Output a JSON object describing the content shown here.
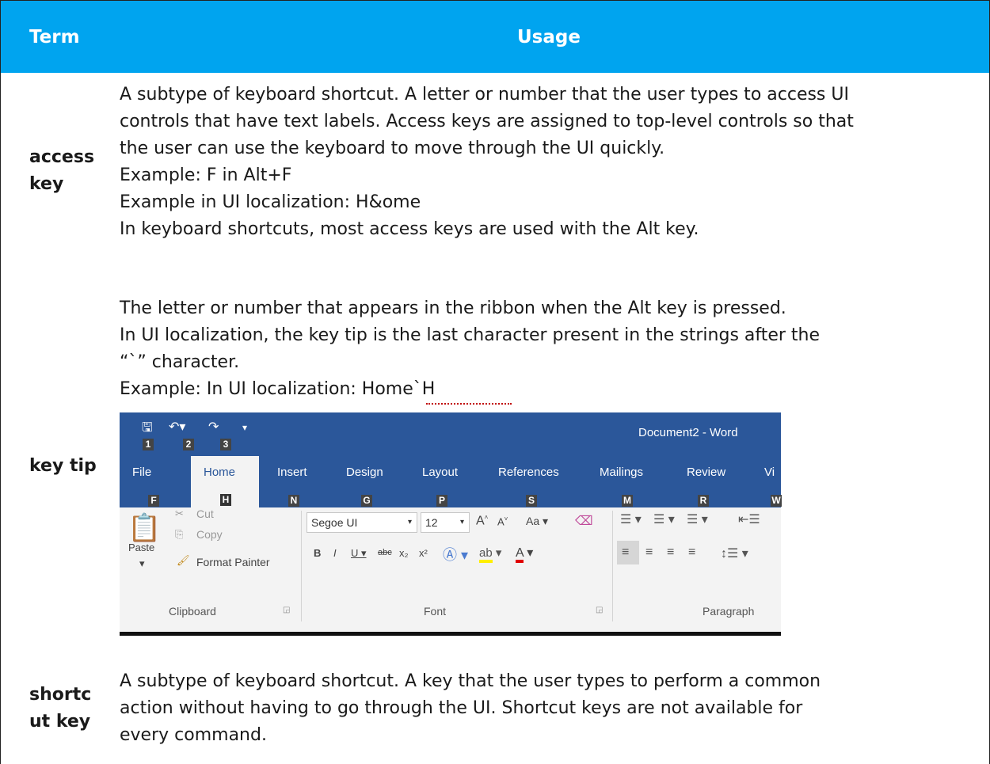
{
  "header": {
    "term": "Term",
    "usage": "Usage"
  },
  "rows": [
    {
      "term_line1": "access",
      "term_line2": "key",
      "usage_lines": [
        "A subtype of keyboard shortcut. A letter or number that the user types to access UI",
        "controls that have text labels. Access keys are assigned to top-level controls so that",
        "the user can use the keyboard to move through the UI quickly.",
        "Example: F in Alt+F",
        "Example in UI localization: H&ome",
        "In keyboard shortcuts, most access keys are used with the Alt key."
      ]
    },
    {
      "term_line1": "key tip",
      "usage_lines": [
        "The letter or number that appears in the ribbon when the Alt key is pressed.",
        "In UI localization, the key tip is the last character present in the strings after the",
        "“`” character.",
        "Example: In UI localization: Home`H"
      ]
    },
    {
      "term_line1": "shortc",
      "term_line2": "ut key",
      "usage_lines": [
        "A subtype of keyboard shortcut. A key that the user types to perform a common",
        "action without having to go through the UI. Shortcut keys are not available for",
        "every command."
      ]
    }
  ],
  "ribbon": {
    "title": "Document2 - Word",
    "qa_tips": [
      "1",
      "2",
      "3"
    ],
    "tabs": [
      {
        "label": "File",
        "tip": "F"
      },
      {
        "label": "Home",
        "tip": "H"
      },
      {
        "label": "Insert",
        "tip": "N"
      },
      {
        "label": "Design",
        "tip": "G"
      },
      {
        "label": "Layout",
        "tip": "P"
      },
      {
        "label": "References",
        "tip": "S"
      },
      {
        "label": "Mailings",
        "tip": "M"
      },
      {
        "label": "Review",
        "tip": "R"
      },
      {
        "label": "Vi",
        "tip": "W"
      }
    ],
    "clipboard": {
      "paste": "Paste",
      "cut": "Cut",
      "copy": "Copy",
      "format_painter": "Format Painter",
      "group": "Clipboard"
    },
    "font": {
      "name": "Segoe UI",
      "size": "12",
      "case": "Aa",
      "group": "Font"
    },
    "paragraph": {
      "group": "Paragraph"
    }
  }
}
